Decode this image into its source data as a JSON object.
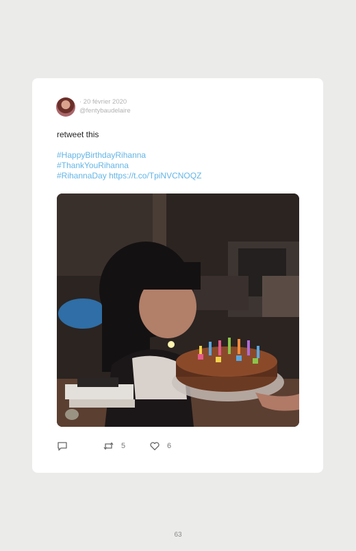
{
  "tweet": {
    "date": "· 20 février 2020",
    "handle": "@fentybaudelaire",
    "text": "retweet this",
    "hashtags": [
      "#HappyBirthdayRihanna",
      "#ThankYouRihanna",
      "#RihannaDay"
    ],
    "link": "https://t.co/TpiNVCNOQZ",
    "retweets": "5",
    "likes": "6"
  },
  "icons": {
    "reply": "speech-bubble-icon",
    "retweet": "retweet-arrows-icon",
    "like": "heart-outline-icon"
  },
  "colors": {
    "link": "#63b5e6",
    "background": "#ebebea",
    "card": "#ffffff"
  },
  "page": {
    "number": "63"
  }
}
